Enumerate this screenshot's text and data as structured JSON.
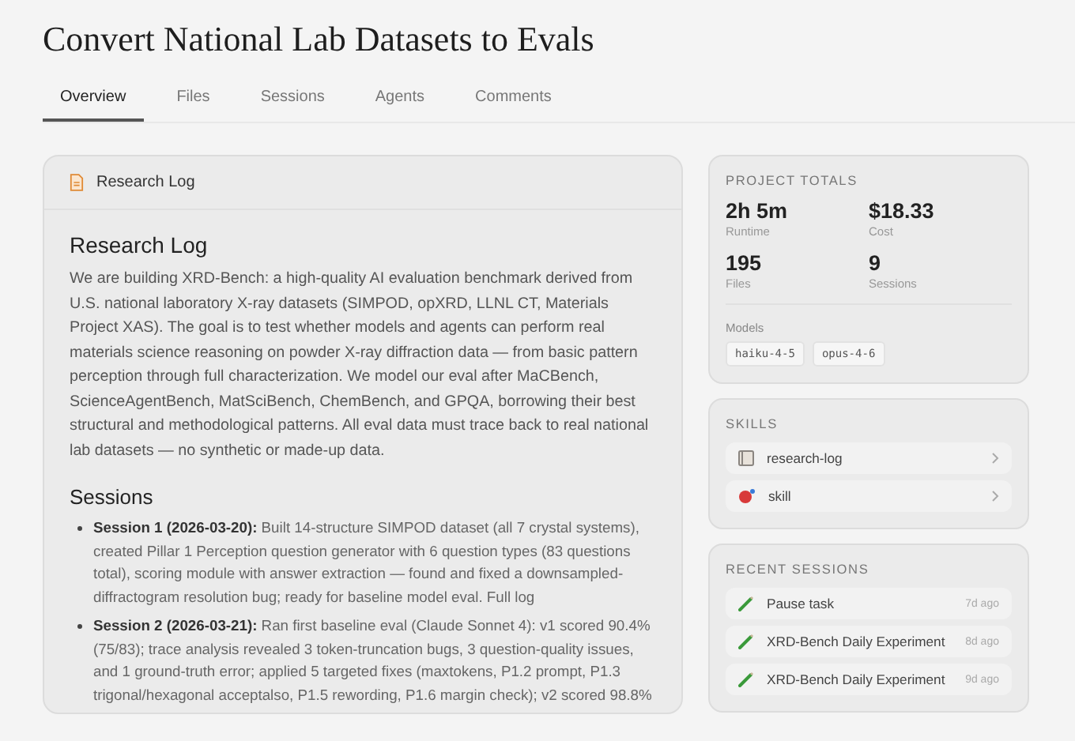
{
  "title": "Convert National Lab Datasets to Evals",
  "tabs": [
    {
      "label": "Overview",
      "selected": true
    },
    {
      "label": "Files",
      "selected": false
    },
    {
      "label": "Sessions",
      "selected": false
    },
    {
      "label": "Agents",
      "selected": false
    },
    {
      "label": "Comments",
      "selected": false
    }
  ],
  "research_log": {
    "header": "Research Log",
    "heading": "Research Log",
    "paragraph": "We are building XRD-Bench: a high-quality AI evaluation benchmark derived from U.S. national laboratory X-ray datasets (SIMPOD, opXRD, LLNL CT, Materials Project XAS). The goal is to test whether models and agents can perform real materials science reasoning on powder X-ray diffraction data — from basic pattern perception through full characterization. We model our eval after MaCBench, ScienceAgentBench, MatSciBench, ChemBench, and GPQA, borrowing their best structural and methodological patterns. All eval data must trace back to real national lab datasets — no synthetic or made-up data.",
    "sessions_heading": "Sessions",
    "sessions": [
      {
        "text": "**Session 1 (2026-03-20):** Built 14-structure SIMPOD dataset (all 7 crystal systems), created Pillar 1 Perception question generator with 6 question types (83 questions total), scoring module with answer extraction — found and fixed a downsampled-diffractogram resolution bug; ready for baseline model eval. Full log"
      },
      {
        "text": "**Session 2 (2026-03-21):** Ran first baseline eval (Claude Sonnet 4): v1 scored 90.4% (75/83); trace analysis revealed 3 token-truncation bugs, 3 question-quality issues, and 1 ground-truth error; applied 5 targeted fixes (maxtokens, P1.2 prompt, P1.3 trigonal/hexagonal acceptalso, P1.5 rewording, P1.6 margin check); v2 scored 98.8%"
      }
    ]
  },
  "project_totals": {
    "title": "PROJECT TOTALS",
    "stats": [
      {
        "value": "2h 5m",
        "label": "Runtime"
      },
      {
        "value": "$18.33",
        "label": "Cost"
      },
      {
        "value": "195",
        "label": "Files"
      },
      {
        "value": "9",
        "label": "Sessions"
      }
    ],
    "models_label": "Models",
    "models": [
      "haiku-4-5",
      "opus-4-6"
    ]
  },
  "skills": {
    "title": "SKILLS",
    "items": [
      {
        "name": "research-log",
        "kind": "notebook"
      },
      {
        "name": "skill",
        "kind": "ball"
      }
    ]
  },
  "recent_sessions": {
    "title": "RECENT SESSIONS",
    "items": [
      {
        "name": "Pause task",
        "time": "7d ago"
      },
      {
        "name": "XRD-Bench Daily Experiment",
        "time": "8d ago"
      },
      {
        "name": "XRD-Bench Daily Experiment",
        "time": "9d ago"
      }
    ]
  }
}
